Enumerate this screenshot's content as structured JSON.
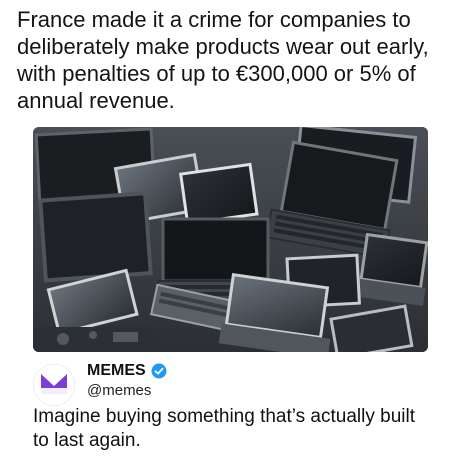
{
  "headline": "France made it a crime for companies to deliberately make products wear out early, with penalties of up to €300,000 or 5% of annual revenue.",
  "media": {
    "subject": "pile of discarded laptops and tablets"
  },
  "author": {
    "display_name": "MEMES",
    "handle": "@memes",
    "avatar_text": "MEMES",
    "verified_icon": "verified-badge-icon",
    "avatar_color": "#7b3fd0",
    "verified_color": "#1d9bf0"
  },
  "tweet": {
    "text": "Imagine buying something that’s actually built to last again."
  }
}
